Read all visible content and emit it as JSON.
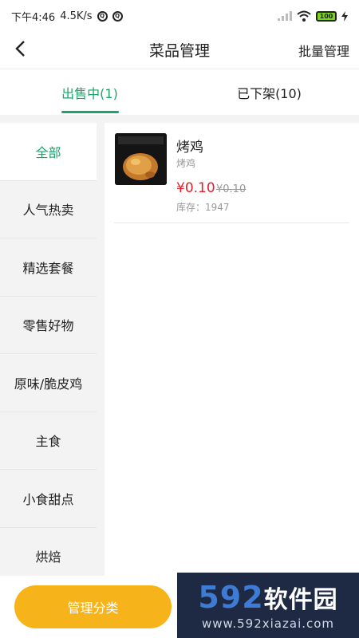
{
  "status_bar": {
    "time": "下午4:46",
    "speed": "4.5K/s",
    "battery": "100"
  },
  "nav": {
    "title": "菜品管理",
    "action": "批量管理"
  },
  "tabs": [
    {
      "label": "出售中(1)",
      "active": true
    },
    {
      "label": "已下架(10)",
      "active": false
    }
  ],
  "sidebar": {
    "items": [
      {
        "label": "全部",
        "active": true
      },
      {
        "label": "人气热卖",
        "active": false
      },
      {
        "label": "精选套餐",
        "active": false
      },
      {
        "label": "零售好物",
        "active": false
      },
      {
        "label": "原味/脆皮鸡",
        "active": false
      },
      {
        "label": "主食",
        "active": false
      },
      {
        "label": "小食甜点",
        "active": false
      },
      {
        "label": "烘焙",
        "active": false
      }
    ]
  },
  "products": [
    {
      "name": "烤鸡",
      "desc": "烤鸡",
      "price": "¥0.10",
      "original_price": "¥0.10",
      "stock": "库存：1947"
    }
  ],
  "bottom": {
    "manage_label": "管理分类"
  },
  "watermark": {
    "brand_num": "592",
    "brand_cn": "软件园",
    "site": "www.592xiazai.com"
  },
  "colors": {
    "accent": "#1aa56a",
    "price": "#e0202b",
    "button": "#f6b31a"
  }
}
